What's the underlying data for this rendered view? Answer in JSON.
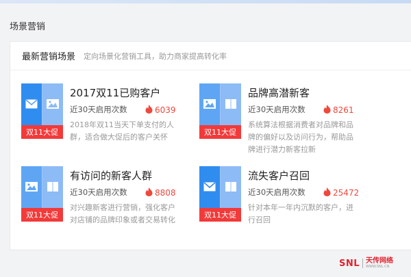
{
  "page": {
    "title": "场景营销"
  },
  "panel": {
    "title": "最新营销场景",
    "subtitle": "定向场景化营销工具，助力商家提高转化率"
  },
  "stat_label": "近30天启用次数",
  "cards": [
    {
      "title": "2017双11已购客户",
      "tag": "双11大促",
      "count": "6039",
      "description": "2018年双11当天下单支付的人群，适合做大促后的客户关怀",
      "icons": [
        "envelope-icon",
        "image-icon"
      ]
    },
    {
      "title": "品牌高潜新客",
      "tag": "双11大促",
      "count": "8261",
      "description": "系统算法根据消费者对品牌和品牌的偏好以及访问行为，帮助品牌进行潜力新客拉新",
      "icons": [
        "image-icon",
        "book-icon"
      ]
    },
    {
      "title": "有访问的新客人群",
      "tag": "双11大促",
      "count": "8808",
      "description": "对兴趣新客进行营销，强化客户对店铺的品牌印象或者交易转化",
      "icons": [
        "image-icon",
        "book-icon"
      ]
    },
    {
      "title": "流失客户召回",
      "tag": "双11大促",
      "count": "25472",
      "description": "针对本年一年内沉默的客户，进行召回",
      "icons": [
        "envelope-icon",
        "book-icon"
      ]
    }
  ],
  "watermark": {
    "logo": "SNL",
    "name": "天传网络",
    "sub": "WWW.SNL.CN"
  },
  "colors": {
    "accent_blue": "#5ea6f4",
    "tag_red": "#f23a3a",
    "count_red": "#f0473c"
  }
}
